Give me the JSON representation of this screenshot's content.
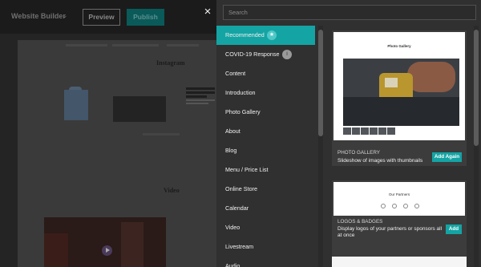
{
  "editor": {
    "site_title": "Website Builder",
    "preview_label": "Preview",
    "publish_label": "Publish",
    "instagram_heading": "Instagram",
    "video_heading": "Video"
  },
  "panel": {
    "close_symbol": "×",
    "search_placeholder": "Search",
    "categories": [
      {
        "label": "Recommended",
        "badge": "★",
        "active": true
      },
      {
        "label": "COVID-19 Response",
        "badge": "i",
        "active": false
      },
      {
        "label": "Content"
      },
      {
        "label": "Introduction"
      },
      {
        "label": "Photo Gallery"
      },
      {
        "label": "About"
      },
      {
        "label": "Blog"
      },
      {
        "label": "Menu / Price List"
      },
      {
        "label": "Online Store"
      },
      {
        "label": "Calendar"
      },
      {
        "label": "Video"
      },
      {
        "label": "Livestream"
      },
      {
        "label": "Audio"
      }
    ],
    "cards": [
      {
        "preview_title": "Photo Gallery",
        "label": "PHOTO GALLERY",
        "description": "Slideshow of images with thumbnails",
        "button": "Add Again"
      },
      {
        "preview_title": "Our Partners",
        "label": "LOGOS & BADGES",
        "description": "Display logos of your partners or sponsors all at once",
        "button": "Add"
      }
    ]
  },
  "colors": {
    "accent": "#14a4a4",
    "panel_bg": "#303030",
    "card_bg": "#3c3c3c"
  }
}
